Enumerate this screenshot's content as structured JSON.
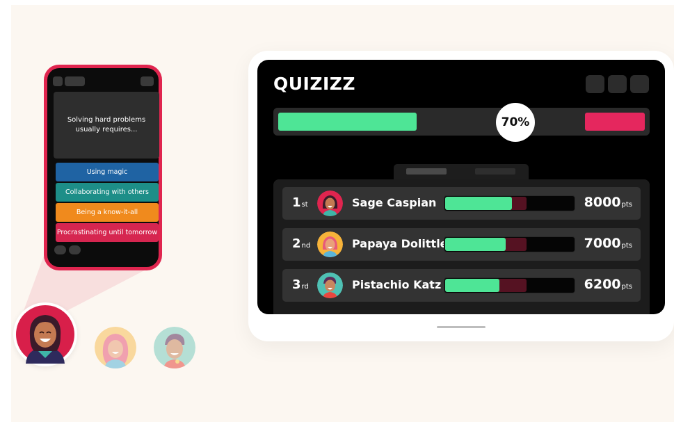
{
  "colors": {
    "background": "#fcf7f1",
    "accent_green": "#4ee596",
    "accent_red": "#e5275e",
    "phone_frame": "#e0254f"
  },
  "phone": {
    "question": "Solving hard problems usually requires...",
    "options": [
      {
        "label": "Using magic",
        "color": "#1f63a3"
      },
      {
        "label": "Collaborating with others",
        "color": "#1d8e88"
      },
      {
        "label": "Being a know-it-all",
        "color": "#f08a1d"
      },
      {
        "label": "Procrastinating until tomorrow",
        "color": "#d62650"
      }
    ]
  },
  "avatars": [
    {
      "name": "avatar-main",
      "icon": "smiling-woman-avatar"
    },
    {
      "name": "avatar-faded-1",
      "icon": "girl-avatar"
    },
    {
      "name": "avatar-faded-2",
      "icon": "boy-avatar"
    }
  ],
  "tablet": {
    "logo": "QUIZIZZ",
    "class_progress_percent": 70,
    "class_progress_label": "70%",
    "leaderboard": [
      {
        "rank": "1",
        "suffix": "st",
        "name": "Sage Caspian",
        "points": "8000",
        "unit": "pts",
        "correct_fraction": 0.52,
        "attempted_fraction": 0.63
      },
      {
        "rank": "2",
        "suffix": "nd",
        "name": "Papaya Dolittle",
        "points": "7000",
        "unit": "pts",
        "correct_fraction": 0.47,
        "attempted_fraction": 0.63
      },
      {
        "rank": "3",
        "suffix": "rd",
        "name": "Pistachio Katz",
        "points": "6200",
        "unit": "pts",
        "correct_fraction": 0.42,
        "attempted_fraction": 0.63
      }
    ]
  }
}
